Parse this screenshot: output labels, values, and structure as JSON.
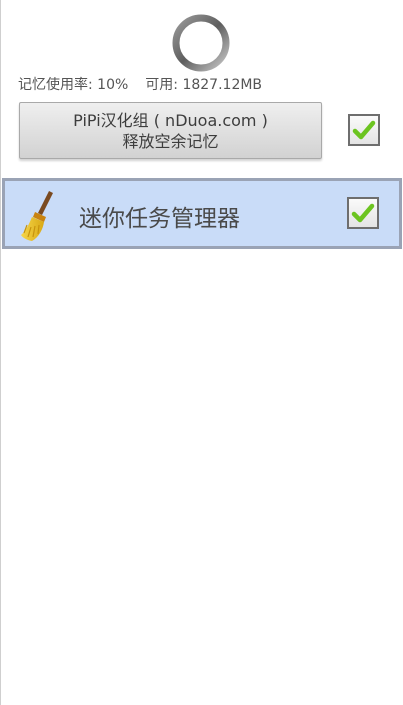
{
  "memory": {
    "usage_label": "记忆使用率: 10%",
    "available_label": "可用: 1827.12MB"
  },
  "free_button": {
    "line1": "PiPi汉化组 ( nDuoa.com )",
    "line2": "释放空余记忆"
  },
  "task_list": [
    {
      "name": "迷你任务管理器",
      "icon": "broom-icon",
      "checked": true
    }
  ],
  "colors": {
    "row_highlight": "#c9dcf8",
    "check_green": "#6cc420"
  }
}
